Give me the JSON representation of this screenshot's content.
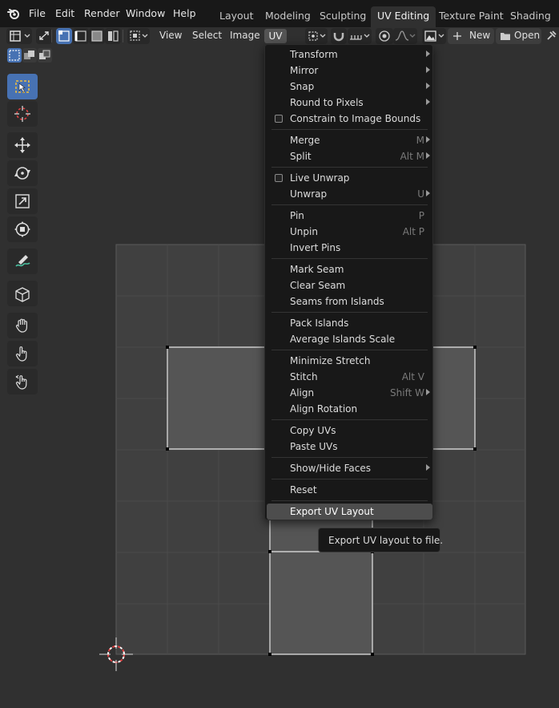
{
  "topbar": {
    "menus": [
      "File",
      "Edit",
      "Render",
      "Window",
      "Help"
    ],
    "workspace_tabs": [
      "Layout",
      "Modeling",
      "Sculpting",
      "UV Editing",
      "Texture Paint",
      "Shading"
    ],
    "active_tab": "UV Editing"
  },
  "header": {
    "menus": [
      "View",
      "Select",
      "Image",
      "UV"
    ],
    "new_label": "New",
    "open_label": "Open"
  },
  "uv_menu": {
    "items": [
      {
        "label": "Transform",
        "submenu": true
      },
      {
        "label": "Mirror",
        "submenu": true
      },
      {
        "label": "Snap",
        "submenu": true
      },
      {
        "label": "Round to Pixels",
        "submenu": true
      },
      {
        "label": "Constrain to Image Bounds",
        "checkbox": true
      },
      {
        "label": "Merge",
        "shortcut": "M",
        "submenu": true
      },
      {
        "label": "Split",
        "shortcut": "Alt M",
        "submenu": true
      },
      {
        "label": "Live Unwrap",
        "checkbox": true
      },
      {
        "label": "Unwrap",
        "shortcut": "U",
        "submenu": true
      },
      {
        "label": "Pin",
        "shortcut": "P"
      },
      {
        "label": "Unpin",
        "shortcut": "Alt P"
      },
      {
        "label": "Invert Pins"
      },
      {
        "label": "Mark Seam"
      },
      {
        "label": "Clear Seam"
      },
      {
        "label": "Seams from Islands"
      },
      {
        "label": "Pack Islands"
      },
      {
        "label": "Average Islands Scale"
      },
      {
        "label": "Minimize Stretch"
      },
      {
        "label": "Stitch",
        "shortcut": "Alt V"
      },
      {
        "label": "Align",
        "shortcut": "Shift W",
        "submenu": true
      },
      {
        "label": "Align Rotation"
      },
      {
        "label": "Copy UVs"
      },
      {
        "label": "Paste UVs"
      },
      {
        "label": "Show/Hide Faces",
        "submenu": true
      },
      {
        "label": "Reset"
      },
      {
        "label": "Export UV Layout",
        "highlighted": true
      }
    ]
  },
  "tooltip": {
    "text": "Export UV layout to file."
  },
  "colors": {
    "accent": "#4772b3",
    "menu_bg": "#181818",
    "highlight": "#4d4d4d",
    "viewport_bg": "#303030"
  }
}
